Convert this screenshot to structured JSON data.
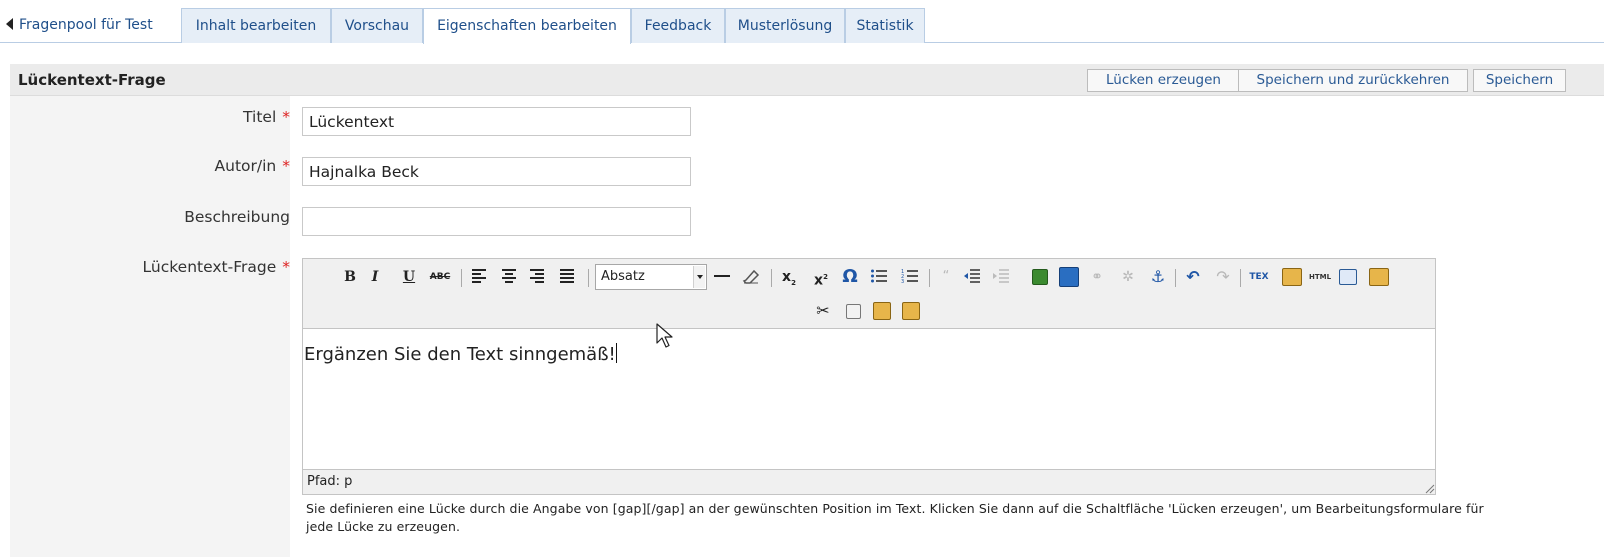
{
  "tabs": {
    "back": "Fragenpool für Test",
    "items": [
      {
        "label": "Inhalt bearbeiten"
      },
      {
        "label": "Vorschau"
      },
      {
        "label": "Eigenschaften bearbeiten",
        "active": true
      },
      {
        "label": "Feedback"
      },
      {
        "label": "Musterlösung"
      },
      {
        "label": "Statistik"
      }
    ]
  },
  "form": {
    "title": "Lückentext-Frage",
    "buttons": {
      "create_gaps": "Lücken erzeugen",
      "save_return": "Speichern und zurückkehren",
      "save": "Speichern"
    },
    "required_mark": "*",
    "fields": {
      "title": {
        "label": "Titel",
        "value": "Lückentext"
      },
      "author": {
        "label": "Autor/in",
        "value": "Hajnalka Beck"
      },
      "description": {
        "label": "Beschreibung",
        "value": ""
      },
      "question": {
        "label": "Lückentext-Frage"
      }
    }
  },
  "editor": {
    "format_select": "Absatz",
    "content": "Ergänzen Sie den Text sinngemäß!",
    "path": "Pfad: p",
    "toolbar_icons": [
      "bold-icon",
      "italic-icon",
      "underline-icon",
      "strikethrough-icon",
      "align-left-icon",
      "align-center-icon",
      "align-right-icon",
      "align-justify-icon",
      "format-select",
      "horizontal-rule-icon",
      "eraser-icon",
      "subscript-icon",
      "superscript-icon",
      "omega-icon",
      "bullet-list-icon",
      "numbered-list-icon",
      "blockquote-icon",
      "outdent-icon",
      "indent-icon",
      "image-icon",
      "media-icon",
      "link-icon",
      "unlink-icon",
      "anchor-icon",
      "undo-icon",
      "redo-icon",
      "tex-icon",
      "paste-word-icon",
      "html-icon",
      "fullscreen-icon",
      "paste-plain-icon",
      "cut-icon",
      "copy-icon",
      "paste-icon",
      "paste-text-icon"
    ],
    "toolbar_labels": {
      "bold": "B",
      "italic": "I",
      "underline": "U",
      "strike": "ABC",
      "subscript": "x",
      "superscript": "x",
      "omega": "Ω",
      "tex": "TEX",
      "html": "HTML"
    }
  },
  "help": "Sie definieren eine Lücke durch die Angabe von [gap][/gap] an der gewünschten Position im Text. Klicken Sie dann auf die Schaltfläche 'Lücken erzeugen', um Bearbeitungsformulare für jede Lücke zu erzeugen.",
  "colors": {
    "tab_bg": "#e6eef7",
    "tab_border": "#b9cde4",
    "link": "#1f4f8a",
    "required": "#dd2222",
    "header_bg": "#ebebeb",
    "label_bg": "#f4f4f4"
  }
}
